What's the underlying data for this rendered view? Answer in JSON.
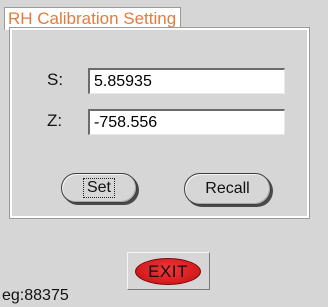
{
  "window": {
    "title": "RH Calibration Setting"
  },
  "fields": {
    "s": {
      "label": "S:",
      "value": "5.85935"
    },
    "z": {
      "label": "Z:",
      "value": "-758.556"
    }
  },
  "buttons": {
    "set": "Set",
    "recall": "Recall",
    "exit": "EXIT"
  },
  "footer": {
    "text": "eg:88375"
  },
  "colors": {
    "title_text": "#e37b3c",
    "background": "#d6d6d6",
    "exit_button": "#e02527"
  }
}
